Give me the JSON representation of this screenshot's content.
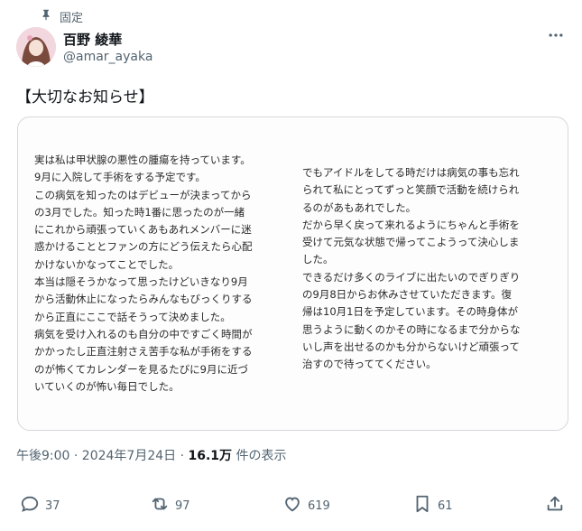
{
  "pinned": {
    "label": "固定",
    "icon": "pin-icon"
  },
  "author": {
    "name": "百野 綾華",
    "handle": "@amar_ayaka"
  },
  "post": {
    "headline": "【大切なお知らせ】",
    "image_text": {
      "left": [
        "実は私は甲状腺の悪性の腫瘍を持っています。",
        "9月に入院して手術をする予定です。",
        "この病気を知ったのはデビューが決まってから",
        "の3月でした。知った時1番に思ったのが一緒",
        "にこれから頑張っていくあもあれメンバーに迷",
        "惑かけることとファンの方にどう伝えたら心配",
        "かけないかなってことでした。",
        "本当は隠そうかなって思ったけどいきなり9月",
        "から活動休止になったらみんなもびっくりする",
        "から正直にここで話そうって決めました。",
        "病気を受け入れるのも自分の中ですごく時間が",
        "かかったし正直注射さえ苦手な私が手術をする",
        "のが怖くてカレンダーを見るたびに9月に近づ",
        "いていくのが怖い毎日でした。"
      ],
      "right": [
        "でもアイドルをしてる時だけは病気の事も忘れ",
        "られて私にとってずっと笑顔で活動を続けられ",
        "るのがあもあれでした。",
        "だから早く戻って来れるようにちゃんと手術を",
        "受けて元気な状態で帰ってこようって決心しま",
        "した。",
        "できるだけ多くのライブに出たいのでぎりぎり",
        "の9月8日からお休みさせていただきます。復",
        "帰は10月1日を予定しています。その時身体が",
        "思うように動くのかその時になるまで分からな",
        "いし声を出せるのかも分からないけど頑張って",
        "治すので待っててください。"
      ]
    },
    "timestamp": "午後9:00 · 2024年7月24日 · ",
    "views_count": "16.1万",
    "views_label": " 件の表示"
  },
  "actions": {
    "reply": {
      "count": "37",
      "icon": "reply-icon"
    },
    "repost": {
      "count": "97",
      "icon": "repost-icon"
    },
    "like": {
      "count": "619",
      "icon": "heart-icon"
    },
    "bookmark": {
      "count": "61",
      "icon": "bookmark-icon"
    },
    "share": {
      "icon": "share-icon"
    }
  },
  "colors": {
    "text_primary": "#0f1419",
    "text_secondary": "#536471",
    "border": "#d3d7db"
  }
}
